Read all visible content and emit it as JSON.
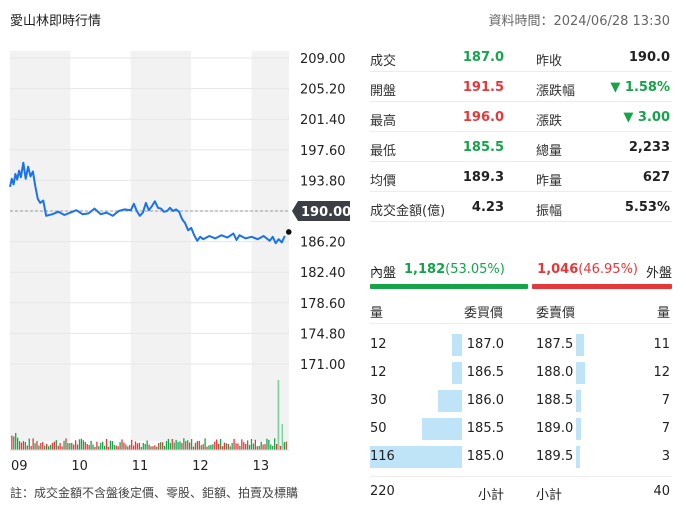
{
  "header": {
    "title": "愛山林即時行情",
    "time_label": "資料時間：2024/06/28 13:30"
  },
  "chart_data": {
    "type": "line",
    "title": "",
    "x_ticks": [
      "09",
      "10",
      "11",
      "12",
      "13"
    ],
    "y_ticks": [
      "209.00",
      "205.20",
      "201.40",
      "197.60",
      "193.80",
      "190.00",
      "186.20",
      "182.40",
      "178.60",
      "174.80",
      "171.00"
    ],
    "ylim": [
      171.0,
      209.0
    ],
    "reference_price": 190.0,
    "reference_label": "190.00",
    "series": [
      {
        "values": [
          [
            0.0,
            193.0
          ],
          [
            0.03,
            194.0
          ],
          [
            0.06,
            193.3
          ],
          [
            0.09,
            194.6
          ],
          [
            0.12,
            193.9
          ],
          [
            0.15,
            195.0
          ],
          [
            0.18,
            194.2
          ],
          [
            0.22,
            196.0
          ],
          [
            0.26,
            194.0
          ],
          [
            0.3,
            195.5
          ],
          [
            0.34,
            194.3
          ],
          [
            0.38,
            194.9
          ],
          [
            0.42,
            193.0
          ],
          [
            0.46,
            191.5
          ],
          [
            0.5,
            191.0
          ],
          [
            0.55,
            191.3
          ],
          [
            0.6,
            189.4
          ],
          [
            0.7,
            189.6
          ],
          [
            0.8,
            189.9
          ],
          [
            0.9,
            189.5
          ],
          [
            1.0,
            189.8
          ],
          [
            1.1,
            190.1
          ],
          [
            1.2,
            189.6
          ],
          [
            1.3,
            189.7
          ],
          [
            1.4,
            190.3
          ],
          [
            1.5,
            189.6
          ],
          [
            1.6,
            189.8
          ],
          [
            1.7,
            189.4
          ],
          [
            1.8,
            190.0
          ],
          [
            1.9,
            190.2
          ],
          [
            2.0,
            190.1
          ],
          [
            2.05,
            190.9
          ],
          [
            2.1,
            190.0
          ],
          [
            2.15,
            189.4
          ],
          [
            2.2,
            189.8
          ],
          [
            2.25,
            191.0
          ],
          [
            2.3,
            190.1
          ],
          [
            2.35,
            190.6
          ],
          [
            2.4,
            191.2
          ],
          [
            2.45,
            190.4
          ],
          [
            2.5,
            190.3
          ],
          [
            2.55,
            189.9
          ],
          [
            2.6,
            190.0
          ],
          [
            2.65,
            190.4
          ],
          [
            2.7,
            190.0
          ],
          [
            2.75,
            190.2
          ],
          [
            2.8,
            189.9
          ],
          [
            2.85,
            189.0
          ],
          [
            2.9,
            188.5
          ],
          [
            2.95,
            187.6
          ],
          [
            3.0,
            187.9
          ],
          [
            3.05,
            187.0
          ],
          [
            3.1,
            186.3
          ],
          [
            3.15,
            186.8
          ],
          [
            3.2,
            186.5
          ],
          [
            3.3,
            186.9
          ],
          [
            3.4,
            186.6
          ],
          [
            3.5,
            187.0
          ],
          [
            3.6,
            186.7
          ],
          [
            3.7,
            187.2
          ],
          [
            3.75,
            186.4
          ],
          [
            3.8,
            187.0
          ],
          [
            3.9,
            186.6
          ],
          [
            4.0,
            186.8
          ],
          [
            4.1,
            186.5
          ],
          [
            4.2,
            186.9
          ],
          [
            4.3,
            186.3
          ],
          [
            4.35,
            186.8
          ],
          [
            4.4,
            186.0
          ],
          [
            4.45,
            186.5
          ],
          [
            4.5,
            186.1
          ],
          [
            4.55,
            186.9
          ]
        ]
      }
    ],
    "volume_peak": {
      "x": 4.43,
      "label": ""
    },
    "colors": {
      "line": "#1a73e8",
      "volume_up": "#e5383b",
      "volume_down": "#16a34a",
      "ref_tag": "#3b3f45"
    }
  },
  "stats": {
    "rows": [
      {
        "l1": "成交",
        "v1": "187.0",
        "c1": "green",
        "l2": "昨收",
        "v2": "190.0",
        "c2": "black"
      },
      {
        "l1": "開盤",
        "v1": "191.5",
        "c1": "red",
        "l2": "漲跌幅",
        "v2": "▼ 1.58%",
        "c2": "green"
      },
      {
        "l1": "最高",
        "v1": "196.0",
        "c1": "red",
        "l2": "漲跌",
        "v2": "▼ 3.00",
        "c2": "green"
      },
      {
        "l1": "最低",
        "v1": "185.5",
        "c1": "green",
        "l2": "總量",
        "v2": "2,233",
        "c2": "black"
      },
      {
        "l1": "均價",
        "v1": "189.3",
        "c1": "black",
        "l2": "昨量",
        "v2": "627",
        "c2": "black"
      },
      {
        "l1": "成交金額(億)",
        "v1": "4.23",
        "c1": "black",
        "l2": "振幅",
        "v2": "5.53%",
        "c2": "black"
      }
    ]
  },
  "inner_outer": {
    "inner_label": "內盤",
    "inner_value": "1,182",
    "inner_pct": "(53.05%)",
    "outer_value": "1,046",
    "outer_pct": "(46.95%)",
    "outer_label": "外盤",
    "inner_fraction": 0.5305
  },
  "order_book": {
    "headers": {
      "bid_vol": "量",
      "bid_price": "委買價",
      "ask_price": "委賣價",
      "ask_vol": "量"
    },
    "rows": [
      {
        "bid_vol": "12",
        "bid_price": "187.0",
        "ask_price": "187.5",
        "ask_vol": "11"
      },
      {
        "bid_vol": "12",
        "bid_price": "186.5",
        "ask_price": "188.0",
        "ask_vol": "12"
      },
      {
        "bid_vol": "30",
        "bid_price": "186.0",
        "ask_price": "188.5",
        "ask_vol": "7"
      },
      {
        "bid_vol": "50",
        "bid_price": "185.5",
        "ask_price": "189.0",
        "ask_vol": "7"
      },
      {
        "bid_vol": "116",
        "bid_price": "185.0",
        "ask_price": "189.5",
        "ask_vol": "3"
      }
    ],
    "summary": {
      "bid_total": "220",
      "bid_label": "小計",
      "ask_label": "小計",
      "ask_total": "40"
    }
  },
  "footnote": "註：成交金額不含盤後定價、零股、鉅額、拍賣及標購"
}
